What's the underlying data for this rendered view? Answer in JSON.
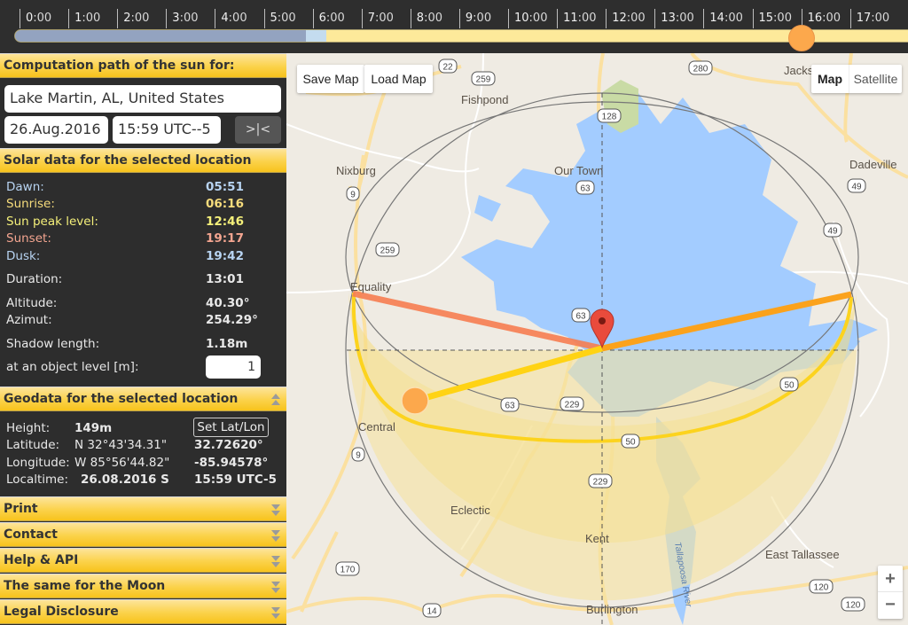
{
  "timeline": {
    "hours": [
      "0",
      "1",
      "2",
      "3",
      "4",
      "5",
      "6",
      "7",
      "8",
      "9",
      "10",
      "11",
      "12",
      "13",
      "14",
      "15",
      "16",
      "17"
    ],
    "minutes_suffix": ":00",
    "current_time_hours": 16.0,
    "night_end_hours": 5.85,
    "dawn_end_hours": 6.27,
    "colors": {
      "night": "#93a3c0",
      "twilight": "#c4dcef",
      "day": "#fde99a",
      "knob": "#fca84c"
    }
  },
  "sidebar": {
    "computation_header": "Computation path of the sun for:",
    "location_input": "Lake Martin, AL, United States",
    "date_input": "26.Aug.2016",
    "time_input": "15:59 UTC--5",
    "sync_button": ">|<",
    "solar_header": "Solar data for the selected location",
    "solar": {
      "dawn_label": "Dawn:",
      "dawn": "05:51",
      "sunrise_label": "Sunrise:",
      "sunrise": "06:16",
      "peak_label": "Sun peak level:",
      "peak": "12:46",
      "sunset_label": "Sunset:",
      "sunset": "19:17",
      "dusk_label": "Dusk:",
      "dusk": "19:42",
      "duration_label": "Duration:",
      "duration": "13:01",
      "altitude_label": "Altitude:",
      "altitude": "40.30°",
      "azimut_label": "Azimut:",
      "azimut": "254.29°",
      "shadow_label": "Shadow length:",
      "shadow": "1.18m",
      "object_level_label": "at an object level [m]:",
      "object_level": "1"
    },
    "geo_header": "Geodata for the selected location",
    "geo": {
      "height_label": "Height:",
      "height": "149m",
      "set_latlon_button": "Set Lat/Lon",
      "lat_label": "Latitude:",
      "lat_dms": "N 32°43'34.31\"",
      "lat_dec": "32.72620°",
      "lon_label": "Longitude:",
      "lon_dms": "W 85°56'44.82\"",
      "lon_dec": "-85.94578°",
      "localtime_label": "Localtime:",
      "local_date": "26.08.2016 S",
      "local_time": "15:59 UTC-5"
    },
    "sections": [
      "Print",
      "Contact",
      "Help & API",
      "The same for the Moon",
      "Legal Disclosure"
    ]
  },
  "map": {
    "save_map": "Save Map",
    "load_map": "Load Map",
    "map_type_map": "Map",
    "map_type_satellite": "Satellite",
    "zoom_in": "+",
    "zoom_out": "−",
    "places": {
      "fishpond": "Fishpond",
      "nixburg": "Nixburg",
      "our_town": "Our Town",
      "jackson": "Jacks",
      "dadeville": "Dadeville",
      "equality": "Equality",
      "central": "Central",
      "eclectic": "Eclectic",
      "kent": "Kent",
      "east_tallassee": "East Tallassee",
      "burlington": "Burlington",
      "river": "Tallapoosa River"
    },
    "shields": {
      "r22": "22",
      "r259a": "259",
      "r280": "280",
      "r128": "128",
      "r9a": "9",
      "r63a": "63",
      "r49a": "49",
      "r49b": "49",
      "r259b": "259",
      "r63b": "63",
      "r63c": "63",
      "r229a": "229",
      "r50a": "50",
      "r50b": "50",
      "r9b": "9",
      "r229b": "229",
      "r170": "170",
      "r14": "14",
      "r120a": "120",
      "r120b": "120"
    },
    "colors": {
      "water": "#a3ccff",
      "land": "#efebe3",
      "sun_fill": "#f5e3a0",
      "sunset_line": "#f67d50",
      "sunrise_line": "#ffd314",
      "current_line": "#fba21c",
      "marker": "#e94b3c"
    }
  }
}
